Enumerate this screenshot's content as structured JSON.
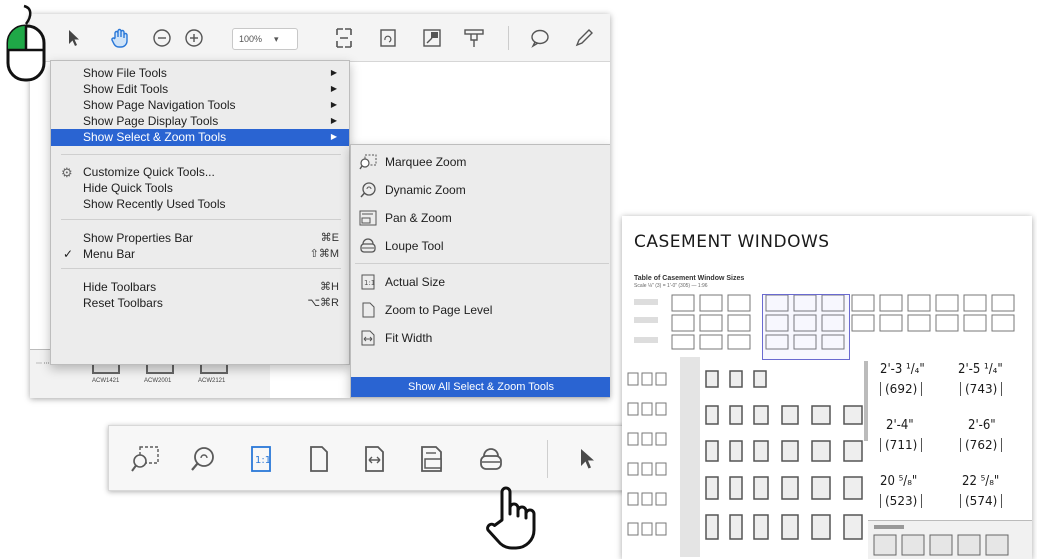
{
  "toolbar": {
    "zoom_value": "100%",
    "zoom_caret": "▾"
  },
  "menu": {
    "items": [
      {
        "label": "Show File Tools",
        "submenu": true
      },
      {
        "label": "Show Edit Tools",
        "submenu": true
      },
      {
        "label": "Show Page Navigation Tools",
        "submenu": true
      },
      {
        "label": "Show Page Display Tools",
        "submenu": true
      },
      {
        "label": "Show Select & Zoom Tools",
        "submenu": true,
        "selected": true
      },
      {
        "label": "Customize Quick Tools..."
      },
      {
        "label": "Hide Quick Tools"
      },
      {
        "label": "Show Recently Used Tools"
      },
      {
        "label": "Show Properties Bar",
        "shortcut": "⌘E"
      },
      {
        "label": "Menu Bar",
        "shortcut": "⇧⌘M",
        "checked": true
      },
      {
        "label": "Hide Toolbars",
        "shortcut": "⌘H"
      },
      {
        "label": "Reset Toolbars",
        "shortcut": "⌥⌘R"
      }
    ],
    "arrow": "▶",
    "check": "✓",
    "gear": "⚙"
  },
  "submenu": {
    "items": [
      {
        "label": "Marquee Zoom",
        "icon": "marquee-zoom-icon"
      },
      {
        "label": "Dynamic Zoom",
        "icon": "dynamic-zoom-icon"
      },
      {
        "label": "Pan & Zoom",
        "icon": "pan-zoom-icon"
      },
      {
        "label": "Loupe Tool",
        "icon": "loupe-tool-icon"
      },
      {
        "label": "Actual Size",
        "icon": "actual-size-icon"
      },
      {
        "label": "Zoom to Page Level",
        "icon": "zoom-to-page-icon"
      },
      {
        "label": "Fit Width",
        "icon": "fit-width-icon"
      },
      {
        "label": "Show All Select & Zoom Tools",
        "selected": true
      }
    ]
  },
  "doc_strip": {
    "labels": [
      "ACW1421",
      "ACW2001",
      "ACW2121"
    ]
  },
  "bottom_toolbar": {
    "icons": [
      "marquee-zoom-icon",
      "dynamic-zoom-icon",
      "actual-size-icon",
      "zoom-to-page-icon",
      "fit-width-icon",
      "pan-zoom-icon",
      "loupe-tool-icon",
      "select-arrow-icon",
      "hand-tool-icon"
    ]
  },
  "document": {
    "title": "CASEMENT WINDOWS",
    "subtitle": "Table of Casement Window Sizes",
    "scale_note": "Scale ⅛\" (3) = 1'-0\" (305) — 1:96",
    "dimensions": [
      {
        "label": "2'-3 ¹/₄\"",
        "metric": "(692)"
      },
      {
        "label": "2'-5 ¹/₄\"",
        "metric": "(743)"
      },
      {
        "label": "2'-4\"",
        "metric": "(711)"
      },
      {
        "label": "2'-6\"",
        "metric": "(762)"
      },
      {
        "label": "20 ⁵/₈\"",
        "metric": "(523)"
      },
      {
        "label": "22 ⁵/₈\"",
        "metric": "(574)"
      }
    ]
  },
  "colors": {
    "selection_blue": "#2a64d2",
    "icon_blue": "#2a78d8",
    "icon_gray": "#5a5a5a"
  }
}
